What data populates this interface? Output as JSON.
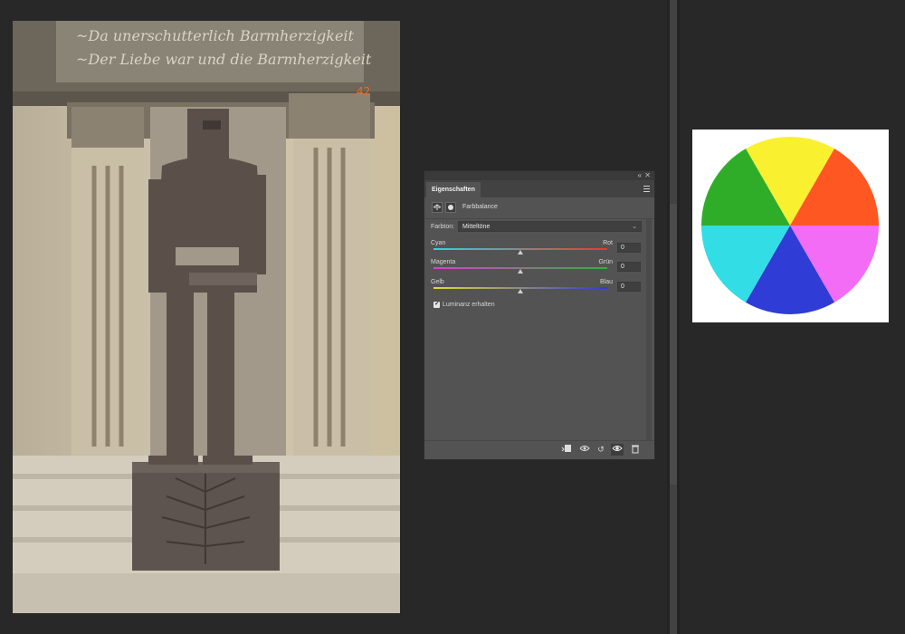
{
  "panel": {
    "tab": "Eigenschaften",
    "adjustment_title": "Farbbalance",
    "tone_label": "Farbton:",
    "tone_value": "Mitteltöne",
    "sliders": [
      {
        "left": "Cyan",
        "right": "Rot",
        "value": "0",
        "level": 0.5,
        "colors": [
          "#2fd3e2",
          "#e73a2c"
        ]
      },
      {
        "left": "Magenta",
        "right": "Grün",
        "value": "0",
        "level": 0.5,
        "colors": [
          "#e43ad6",
          "#2fb33a"
        ]
      },
      {
        "left": "Gelb",
        "right": "Blau",
        "value": "0",
        "level": 0.5,
        "colors": [
          "#e7d92e",
          "#2f3ad8"
        ]
      }
    ],
    "preserve_luminosity_label": "Luminanz erhalten",
    "preserve_luminosity_checked": true,
    "footer_icons": [
      "clip-to-layer-icon",
      "view-previous-icon",
      "reset-icon",
      "visibility-eye-icon",
      "trash-icon"
    ],
    "topbar_icons": [
      "collapse-icon",
      "close-icon"
    ]
  },
  "color_wheel": {
    "segments": [
      "#f9f12f",
      "#ff5722",
      "#f36cf6",
      "#2f3cd6",
      "#32dde6",
      "#2fad28"
    ]
  }
}
